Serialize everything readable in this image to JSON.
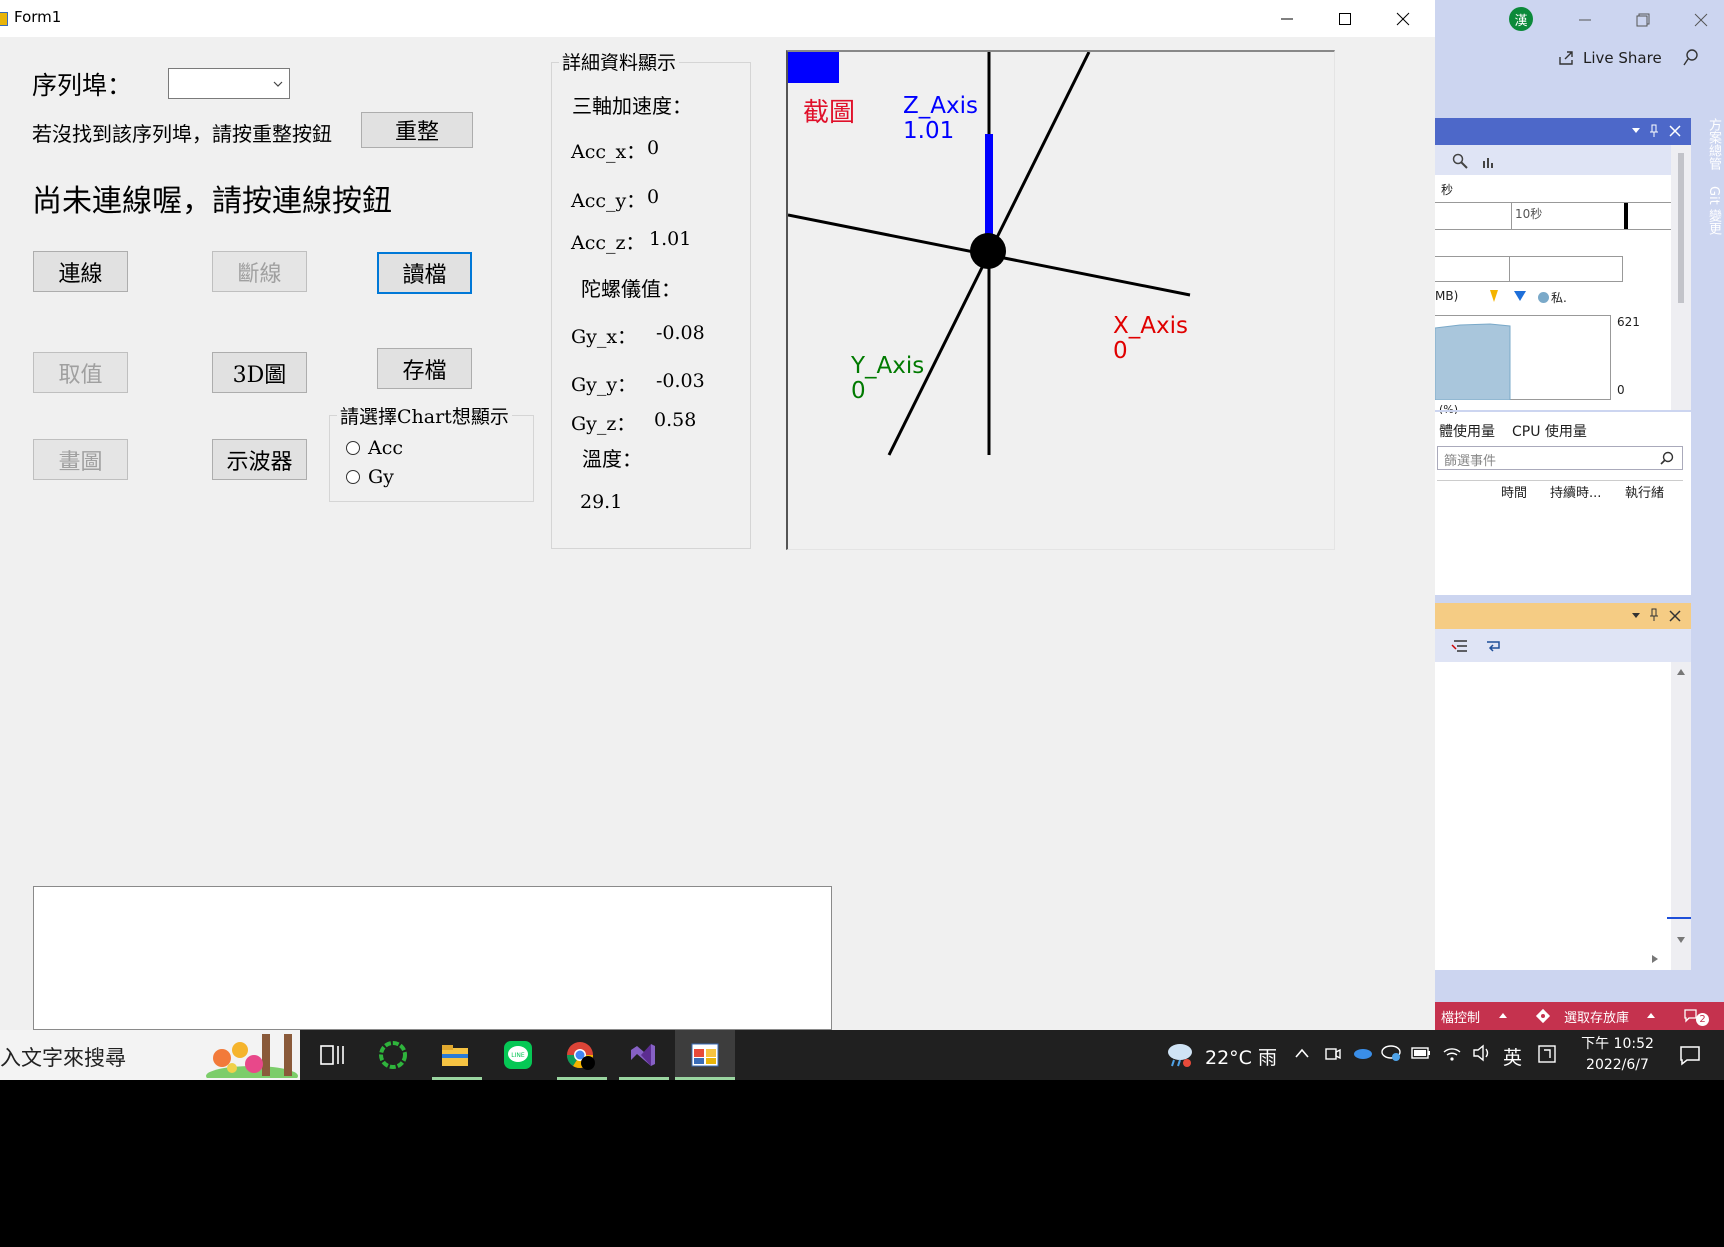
{
  "window": {
    "title": "Form1"
  },
  "port": {
    "label": "序列埠：",
    "selected": ""
  },
  "hint_text": "若沒找到該序列埠，請按重整按鈕",
  "refresh_label": "重整",
  "status_text": "尚未連線喔，請按連線按鈕",
  "buttons": {
    "connect": "連線",
    "disconnect": "斷線",
    "read_file": "讀檔",
    "get_value": "取值",
    "plot3d": "3D圖",
    "save_file": "存檔",
    "draw": "畫圖",
    "scope": "示波器"
  },
  "chart_select": {
    "title": "請選擇Chart想顯示",
    "options": [
      "Acc",
      "Gy"
    ]
  },
  "details": {
    "title": "詳細資料顯示",
    "acc_heading": "三軸加速度：",
    "acc_x_label": "Acc_x：",
    "acc_x": "0",
    "acc_y_label": "Acc_y：",
    "acc_y": "0",
    "acc_z_label": "Acc_z：",
    "acc_z": "1.01",
    "gyro_heading": "陀螺儀值：",
    "gy_x_label": "Gy_x：",
    "gy_x": "-0.08",
    "gy_y_label": "Gy_y：",
    "gy_y": "-0.03",
    "gy_z_label": "Gy_z：",
    "gy_z": "0.58",
    "temp_heading": "溫度：",
    "temp": "29.1"
  },
  "axes3d": {
    "screenshot_label": "截圖",
    "z_name": "Z_Axis",
    "z_value": "1.01",
    "x_name": "X_Axis",
    "x_value": "0",
    "y_name": "Y_Axis",
    "y_value": "0",
    "colors": {
      "x": "#e00000",
      "y": "#007a00",
      "z": "#0000ff",
      "screenshot": "#e0102a"
    }
  },
  "vs_panel": {
    "avatar_letter": "漢",
    "live_share": "Live Share",
    "side_tabs": [
      "方案總管",
      "Git 變更"
    ],
    "seconds_label": "秒",
    "tick_10s": "10秒",
    "mem_label": "MB)",
    "private_label": "私.",
    "mem_max": "621",
    "mem_min": "0",
    "pct_label": "(%)",
    "tab_mem": "體使用量",
    "tab_cpu": "CPU 使用量",
    "filter_placeholder": "篩選事件",
    "col_time": "時間",
    "col_duration": "持續時...",
    "col_thread": "執行緒",
    "status_left": "檔控制",
    "status_repo": "選取存放庫",
    "notif_count": "2"
  },
  "taskbar": {
    "search_placeholder": "入文字來搜尋",
    "weather": "22°C 雨",
    "ime": "英",
    "time": "下午 10:52",
    "date": "2022/6/7"
  }
}
